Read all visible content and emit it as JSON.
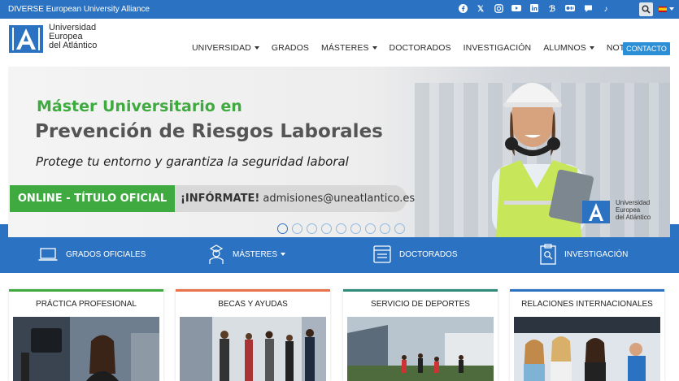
{
  "topbar": {
    "alliance": "DIVERSE European University Alliance",
    "social_icons": [
      "facebook-icon",
      "x-icon",
      "instagram-icon",
      "youtube-icon",
      "linkedin-icon",
      "behance-icon",
      "medium-icon",
      "chat-icon",
      "tiktok-icon"
    ],
    "language": "es"
  },
  "header": {
    "logo_line1": "Universidad",
    "logo_line2": "Europea",
    "logo_line3": "del Atlántico",
    "nav": [
      {
        "label": "UNIVERSIDAD",
        "dropdown": true
      },
      {
        "label": "GRADOS",
        "dropdown": false
      },
      {
        "label": "MÁSTERES",
        "dropdown": true
      },
      {
        "label": "DOCTORADOS",
        "dropdown": false
      },
      {
        "label": "INVESTIGACIÓN",
        "dropdown": false
      },
      {
        "label": "ALUMNOS",
        "dropdown": true
      },
      {
        "label": "NOTICIAS",
        "dropdown": true
      }
    ],
    "contact": "CONTACTO"
  },
  "hero": {
    "title1": "Máster Universitario en",
    "title2": "Prevención de Riesgos Laborales",
    "subtitle": "Protege tu entorno y garantiza la seguridad laboral",
    "online": "ONLINE - TÍTULO OFICIAL",
    "inform_bold": "¡INFÓRMATE!",
    "inform_email": "admisiones@uneatlantico.es",
    "logo_line1": "Universidad",
    "logo_line2": "Europea",
    "logo_line3": "del Atlántico",
    "slide_count": 9,
    "active_slide": 1
  },
  "quicklinks": {
    "grados": "GRADOS OFICIALES",
    "masteres": "MÁSTERES",
    "doctorados": "DOCTORADOS",
    "investigacion": "INVESTIGACIÓN"
  },
  "cards": [
    {
      "title": "PRÁCTICA PROFESIONAL",
      "color": "#3faa3f"
    },
    {
      "title": "BECAS Y AYUDAS",
      "color": "#e8734a"
    },
    {
      "title": "SERVICIO DE DEPORTES",
      "color": "#2e8b7a"
    },
    {
      "title": "RELACIONES INTERNACIONALES",
      "color": "#2b73c2"
    }
  ]
}
